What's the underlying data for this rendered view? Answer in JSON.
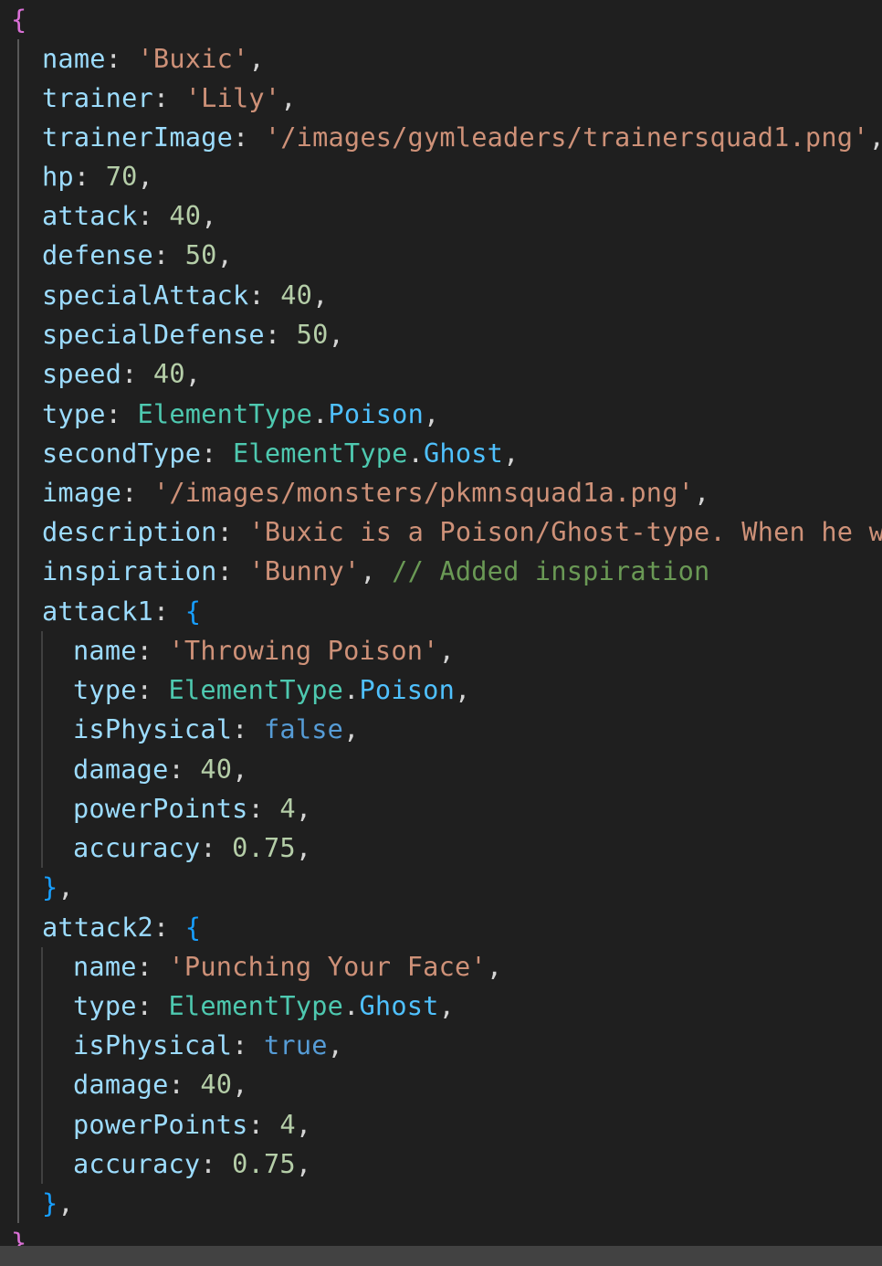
{
  "editor": {
    "open_brace": "{",
    "close_brace": "}",
    "close_trail": ",",
    "fields": {
      "name": {
        "key": "name",
        "value": "'Buxic'"
      },
      "trainer": {
        "key": "trainer",
        "value": "'Lily'"
      },
      "trainerImage": {
        "key": "trainerImage",
        "value": "'/images/gymleaders/trainersquad1.png'"
      },
      "hp": {
        "key": "hp",
        "value": "70"
      },
      "attack": {
        "key": "attack",
        "value": "40"
      },
      "defense": {
        "key": "defense",
        "value": "50"
      },
      "specialAttack": {
        "key": "specialAttack",
        "value": "40"
      },
      "specialDefense": {
        "key": "specialDefense",
        "value": "50"
      },
      "speed": {
        "key": "speed",
        "value": "40"
      },
      "type": {
        "key": "type",
        "class": "ElementType",
        "member": "Poison"
      },
      "secondType": {
        "key": "secondType",
        "class": "ElementType",
        "member": "Ghost"
      },
      "image": {
        "key": "image",
        "value": "'/images/monsters/pkmnsquad1a.png'"
      },
      "description": {
        "key": "description",
        "value": "'Buxic is a Poison/Ghost-type. When he w"
      },
      "inspiration": {
        "key": "inspiration",
        "value": "'Bunny'",
        "comment": "// Added inspiration"
      }
    },
    "attack1": {
      "key": "attack1",
      "open": "{",
      "close": "}",
      "name": {
        "key": "name",
        "value": "'Throwing Poison'"
      },
      "type": {
        "key": "type",
        "class": "ElementType",
        "member": "Poison"
      },
      "isPhysical": {
        "key": "isPhysical",
        "value": "false"
      },
      "damage": {
        "key": "damage",
        "value": "40"
      },
      "powerPoints": {
        "key": "powerPoints",
        "value": "4"
      },
      "accuracy": {
        "key": "accuracy",
        "value": "0.75"
      }
    },
    "attack2": {
      "key": "attack2",
      "open": "{",
      "close": "}",
      "name": {
        "key": "name",
        "value": "'Punching Your Face'"
      },
      "type": {
        "key": "type",
        "class": "ElementType",
        "member": "Ghost"
      },
      "isPhysical": {
        "key": "isPhysical",
        "value": "true"
      },
      "damage": {
        "key": "damage",
        "value": "40"
      },
      "powerPoints": {
        "key": "powerPoints",
        "value": "4"
      },
      "accuracy": {
        "key": "accuracy",
        "value": "0.75"
      }
    },
    "colors": {
      "background": "#1f1f1f",
      "key": "#9cdcfe",
      "string": "#ce9178",
      "number": "#b5cea8",
      "class": "#4ec9b0",
      "member": "#4fc1ff",
      "boolean": "#569cd6",
      "comment": "#6a9955",
      "brace_outer": "#da70d6",
      "brace_inner": "#179fff"
    }
  }
}
